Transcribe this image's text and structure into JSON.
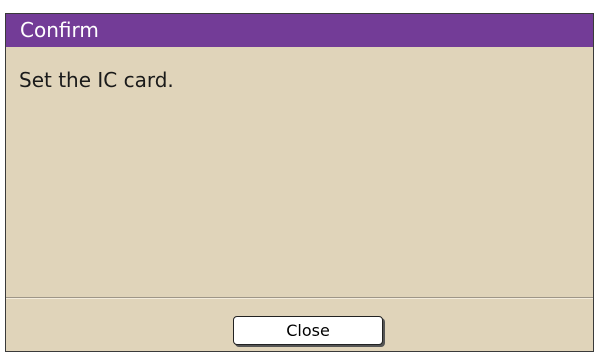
{
  "dialog": {
    "title": "Confirm",
    "message": "Set the IC card.",
    "close_label": "Close"
  },
  "colors": {
    "title_bar": "#733c97",
    "body": "#e0d4ba",
    "button": "#ffffff"
  }
}
